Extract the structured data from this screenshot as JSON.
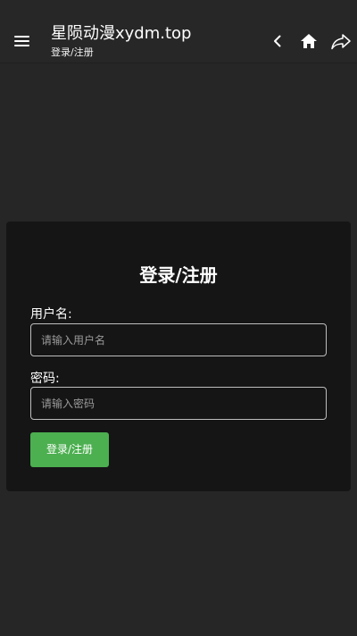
{
  "header": {
    "title": "星陨动漫xydm.top",
    "subtitle": "登录/注册",
    "icons": [
      "menu-icon",
      "back-icon",
      "home-icon",
      "share-icon"
    ]
  },
  "form": {
    "title": "登录/注册",
    "username_label": "用户名:",
    "username_placeholder": "请输入用户名",
    "username_value": "",
    "password_label": "密码:",
    "password_placeholder": "请输入密码",
    "password_value": "",
    "submit_label": "登录/注册"
  },
  "colors": {
    "background": "#262626",
    "card": "#151515",
    "accent": "#4caf50"
  }
}
